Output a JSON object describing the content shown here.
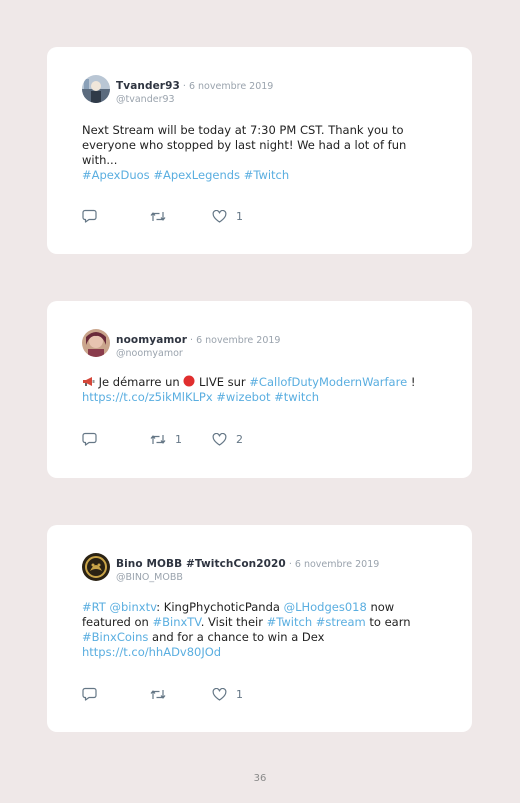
{
  "posts": [
    {
      "name": "Tvander93",
      "sep": " · ",
      "date": "6 novembre 2019",
      "handle": "@tvander93",
      "text": "Next Stream will be today at 7:30 PM CST. Thank you to everyone who stopped by last night! We had a lot of fun with...",
      "tags": [
        "#ApexDuos",
        "#ApexLegends",
        "#Twitch"
      ],
      "retweets": "",
      "likes": "1"
    },
    {
      "name": "noomyamor",
      "sep": " · ",
      "date": "6 novembre 2019",
      "handle": "@noomyamor",
      "text_a": "Je démarre un",
      "text_b": "LIVE sur",
      "link_a": "#CallofDutyModernWarfare",
      "text_c": "!",
      "link_b": "https://t.co/z5ikMlKLPx",
      "link_c": "#wizebot",
      "link_d": "#twitch",
      "retweets": "1",
      "likes": "2"
    },
    {
      "name": "Bino MOBB #TwitchCon2020",
      "sep": " · ",
      "date": "6 novembre 2019",
      "handle": "@BINO_MOBB",
      "rt": "#RT",
      "mention1": "@binxtv",
      "t1": ": KingPhychoticPanda",
      "mention2": "@LHodges018",
      "t2": "now featured on",
      "tag1": "#BinxTV",
      "t3": ". Visit their",
      "tag2": "#Twitch",
      "tag3": "#stream",
      "t4": "to earn",
      "tag4": "#BinxCoins",
      "t5": "and for a chance to win a Dex",
      "url": "https://t.co/hhADv80JOd",
      "retweets": "",
      "likes": "1"
    }
  ],
  "page_number": "36",
  "colors": {
    "link": "#5aaee0",
    "muted": "#9aa3ad",
    "background": "#efe8e8"
  }
}
